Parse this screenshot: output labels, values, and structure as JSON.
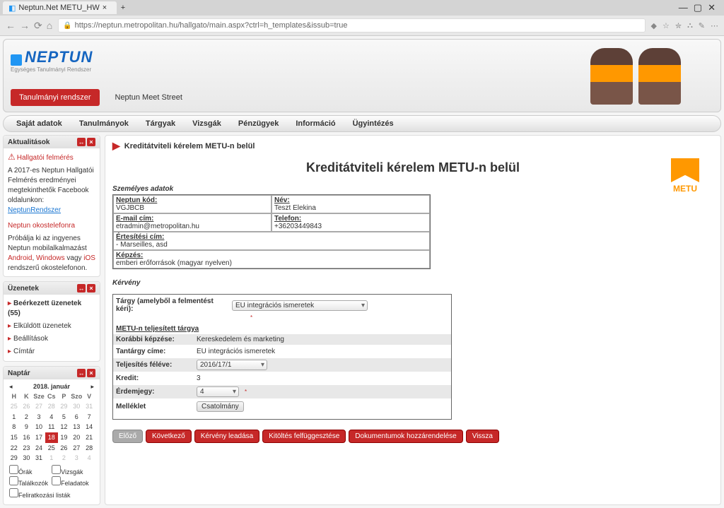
{
  "browser": {
    "tab_title": "Neptun.Net METU_HW",
    "url": "https://neptun.metropolitan.hu/hallgato/main.aspx?ctrl=h_templates&issub=true"
  },
  "logo": {
    "title": "NEPTUN",
    "subtitle": "Egységes Tanulmányi Rendszer"
  },
  "header_nav": {
    "active": "Tanulmányi rendszer",
    "other": "Neptun Meet Street"
  },
  "menu": [
    "Saját adatok",
    "Tanulmányok",
    "Tárgyak",
    "Vizsgák",
    "Pénzügyek",
    "Információ",
    "Ügyintézés"
  ],
  "sidebar": {
    "news_title": "Aktualitások",
    "news_warn": "Hallgatói felmérés",
    "news_text": "A 2017-es Neptun Hallgatói Felmérés eredményei megtekinthetők Facebook oldalunkon:",
    "news_link": "NeptunRendszer",
    "phone_title": "Neptun okostelefonra",
    "phone_text1": "Próbálja ki az ingyenes Neptun mobilalkalmazást ",
    "phone_android": "Android",
    "phone_text2": ", ",
    "phone_windows": "Windows",
    "phone_text3": " vagy ",
    "phone_ios": "iOS",
    "phone_text4": " rendszerű okostelefonon.",
    "msg_title": "Üzenetek",
    "msg_items": [
      "Beérkezett üzenetek (55)",
      "Elküldött üzenetek",
      "Beállítások",
      "Címtár"
    ],
    "cal_title": "Naptár",
    "cal_month": "2018. január",
    "cal_checks": [
      "Órák",
      "Vizsgák",
      "Találkozók",
      "Feladatok",
      "Feliratkozási listák"
    ]
  },
  "breadcrumb": "Kreditátviteli kérelem METU-n belül",
  "page_title": "Kreditátviteli kérelem METU-n belül",
  "personal_section": "Személyes adatok",
  "form": {
    "neptun_label": "Neptun kód:",
    "neptun_value": "VGJBCB",
    "name_label": "Név:",
    "name_value": "Teszt Elekina",
    "email_label": "E-mail cím:",
    "email_value": "etradmin@metropolitan.hu",
    "phone_label": "Telefon:",
    "phone_value": "+36203449843",
    "notif_label": "Értesítési cím:",
    "notif_value": "- Marseilles, asd",
    "training_label": "Képzés:",
    "training_value": "emberi erőforrások (magyar nyelven)"
  },
  "request_section": "Kérvény",
  "request": {
    "subject_label": "Tárgy (amelyből a felmentést kéri):",
    "subject_value": "EU integrációs ismeretek",
    "completed_title": "METU-n teljesített tárgya",
    "prev_label": "Korábbi képzése:",
    "prev_value": "Kereskedelem és marketing",
    "course_label": "Tantárgy címe:",
    "course_value": "EU integrációs ismeretek",
    "semester_label": "Teljesítés féléve:",
    "semester_value": "2016/17/1",
    "credit_label": "Kredit:",
    "credit_value": "3",
    "grade_label": "Érdemjegy:",
    "grade_value": "4",
    "attach_label": "Melléklet",
    "attach_button": "Csatolmány"
  },
  "actions": [
    "Előző",
    "Következő",
    "Kérvény leadása",
    "Kitöltés felfüggesztése",
    "Dokumentumok hozzárendelése",
    "Vissza"
  ],
  "metu_label": "METU"
}
